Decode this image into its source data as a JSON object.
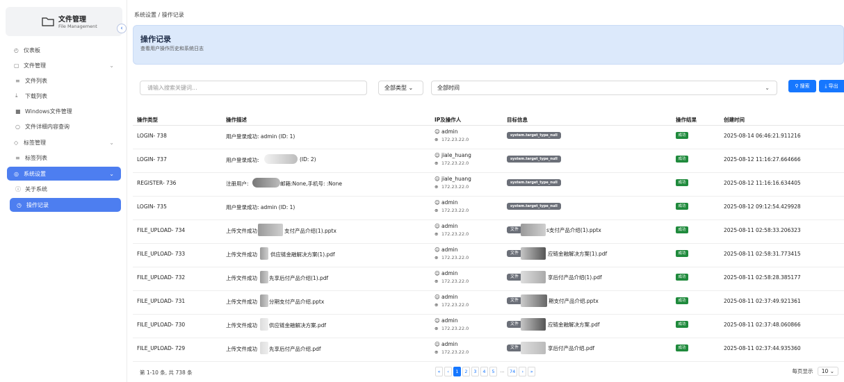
{
  "brand": {
    "title": "文件管理",
    "subtitle": "File Management",
    "collapse_icon": "‹"
  },
  "sidebar": {
    "items": [
      {
        "label": "仪表板",
        "icon": "◴"
      },
      {
        "label": "文件管理",
        "icon": "▢"
      },
      {
        "label": "文件列表",
        "icon": "≡"
      },
      {
        "label": "下载列表",
        "icon": "⤓"
      },
      {
        "label": "Windows文件管理",
        "icon": "■"
      },
      {
        "label": "文件详细内容查询",
        "icon": "○"
      },
      {
        "label": "标签管理",
        "icon": "◇"
      },
      {
        "label": "标签列表",
        "icon": "≡"
      },
      {
        "label": "系统设置",
        "icon": "◎"
      },
      {
        "label": "关于系统",
        "icon": "ⓘ"
      },
      {
        "label": "操作记录",
        "icon": "◷"
      }
    ]
  },
  "breadcrumb": "系统设置 / 操作记录",
  "banner": {
    "title": "操作记录",
    "subtitle": "查看用户操作历史和系统日志"
  },
  "filters": {
    "search_placeholder": "请输入搜索关键词...",
    "type_value": "全部类型",
    "time_value": "全部时间",
    "search_label": "搜索",
    "export_label": "导出"
  },
  "table": {
    "headers": [
      "操作类型",
      "操作描述",
      "IP及操作人",
      "目标信息",
      "操作结果",
      "创建时间"
    ],
    "rows": [
      {
        "type": "LOGIN- 738",
        "desc": "用户登录成功: admin (ID: 1)",
        "user": "admin",
        "ip": "172.23.22.0",
        "target_tag": "system.target_type_null",
        "target": "",
        "result": "成功",
        "time": "2025-08-14 06:46:21.911216"
      },
      {
        "type": "LOGIN- 737",
        "desc": "用户登录成功:",
        "desc2": "(ID: 2)",
        "user": "jiale_huang",
        "ip": "172.23.22.0",
        "target_tag": "system.target_type_null",
        "target": "",
        "result": "成功",
        "time": "2025-08-12 11:16:27.664666"
      },
      {
        "type": "REGISTER- 736",
        "desc": "注册用户:",
        "desc2": "邮箱:None,手机号: :None",
        "user": "jiale_huang",
        "ip": "172.23.22.0",
        "target_tag": "system.target_type_null",
        "target": "",
        "result": "成功",
        "time": "2025-08-12 11:16:16.634405"
      },
      {
        "type": "LOGIN- 735",
        "desc": "用户登录成功: admin (ID: 1)",
        "user": "admin",
        "ip": "172.23.22.0",
        "target_tag": "system.target_type_null",
        "target": "",
        "result": "成功",
        "time": "2025-08-12 09:12:54.429928"
      },
      {
        "type": "FILE_UPLOAD- 734",
        "desc": "上传文件成功",
        "desc2": "支付产品介绍(1).pptx",
        "user": "admin",
        "ip": "172.23.22.0",
        "target_tag": "文件",
        "target": "s支付产品介绍(1).pptx",
        "result": "成功",
        "time": "2025-08-11 02:58:33.206323"
      },
      {
        "type": "FILE_UPLOAD- 733",
        "desc": "上传文件成功",
        "desc2": "供应链金融解决方案(1).pdf",
        "user": "admin",
        "ip": "172.23.22.0",
        "target_tag": "文件",
        "target": "应链金融解决方案(1).pdf",
        "result": "成功",
        "time": "2025-08-11 02:58:31.773415"
      },
      {
        "type": "FILE_UPLOAD- 732",
        "desc": "上传文件成功",
        "desc2": "先享后付产品介绍(1).pdf",
        "user": "admin",
        "ip": "172.23.22.0",
        "target_tag": "文件",
        "target": "享后付产品介绍(1).pdf",
        "result": "成功",
        "time": "2025-08-11 02:58:28.385177"
      },
      {
        "type": "FILE_UPLOAD- 731",
        "desc": "上传文件成功",
        "desc2": "分期支付产品介绍.pptx",
        "user": "admin",
        "ip": "172.23.22.0",
        "target_tag": "文件",
        "target": "期支付产品介绍.pptx",
        "result": "成功",
        "time": "2025-08-11 02:37:49.921361"
      },
      {
        "type": "FILE_UPLOAD- 730",
        "desc": "上传文件成功",
        "desc2": "供应链金融解决方案.pdf",
        "user": "admin",
        "ip": "172.23.22.0",
        "target_tag": "文件",
        "target": "应链金融解决方案.pdf",
        "result": "成功",
        "time": "2025-08-11 02:37:48.060866"
      },
      {
        "type": "FILE_UPLOAD- 729",
        "desc": "上传文件成功",
        "desc2": "先享后付产品介绍.pdf",
        "user": "admin",
        "ip": "172.23.22.0",
        "target_tag": "文件",
        "target": "享后付产品介绍.pdf",
        "result": "成功",
        "time": "2025-08-11 02:37:44.935360"
      }
    ]
  },
  "footer": {
    "total": "第 1-10 条, 共 738 条",
    "pages": [
      "«",
      "‹",
      "1",
      "2",
      "3",
      "4",
      "5",
      "...",
      "74",
      "›",
      "»"
    ],
    "current_page": "1",
    "page_size_label": "每页显示",
    "page_size_value": "10"
  },
  "colors": {
    "accent": "#1677ff",
    "nav_active": "#4d7ef0",
    "success": "#1f8a3c",
    "banner": "#dce9fb"
  }
}
